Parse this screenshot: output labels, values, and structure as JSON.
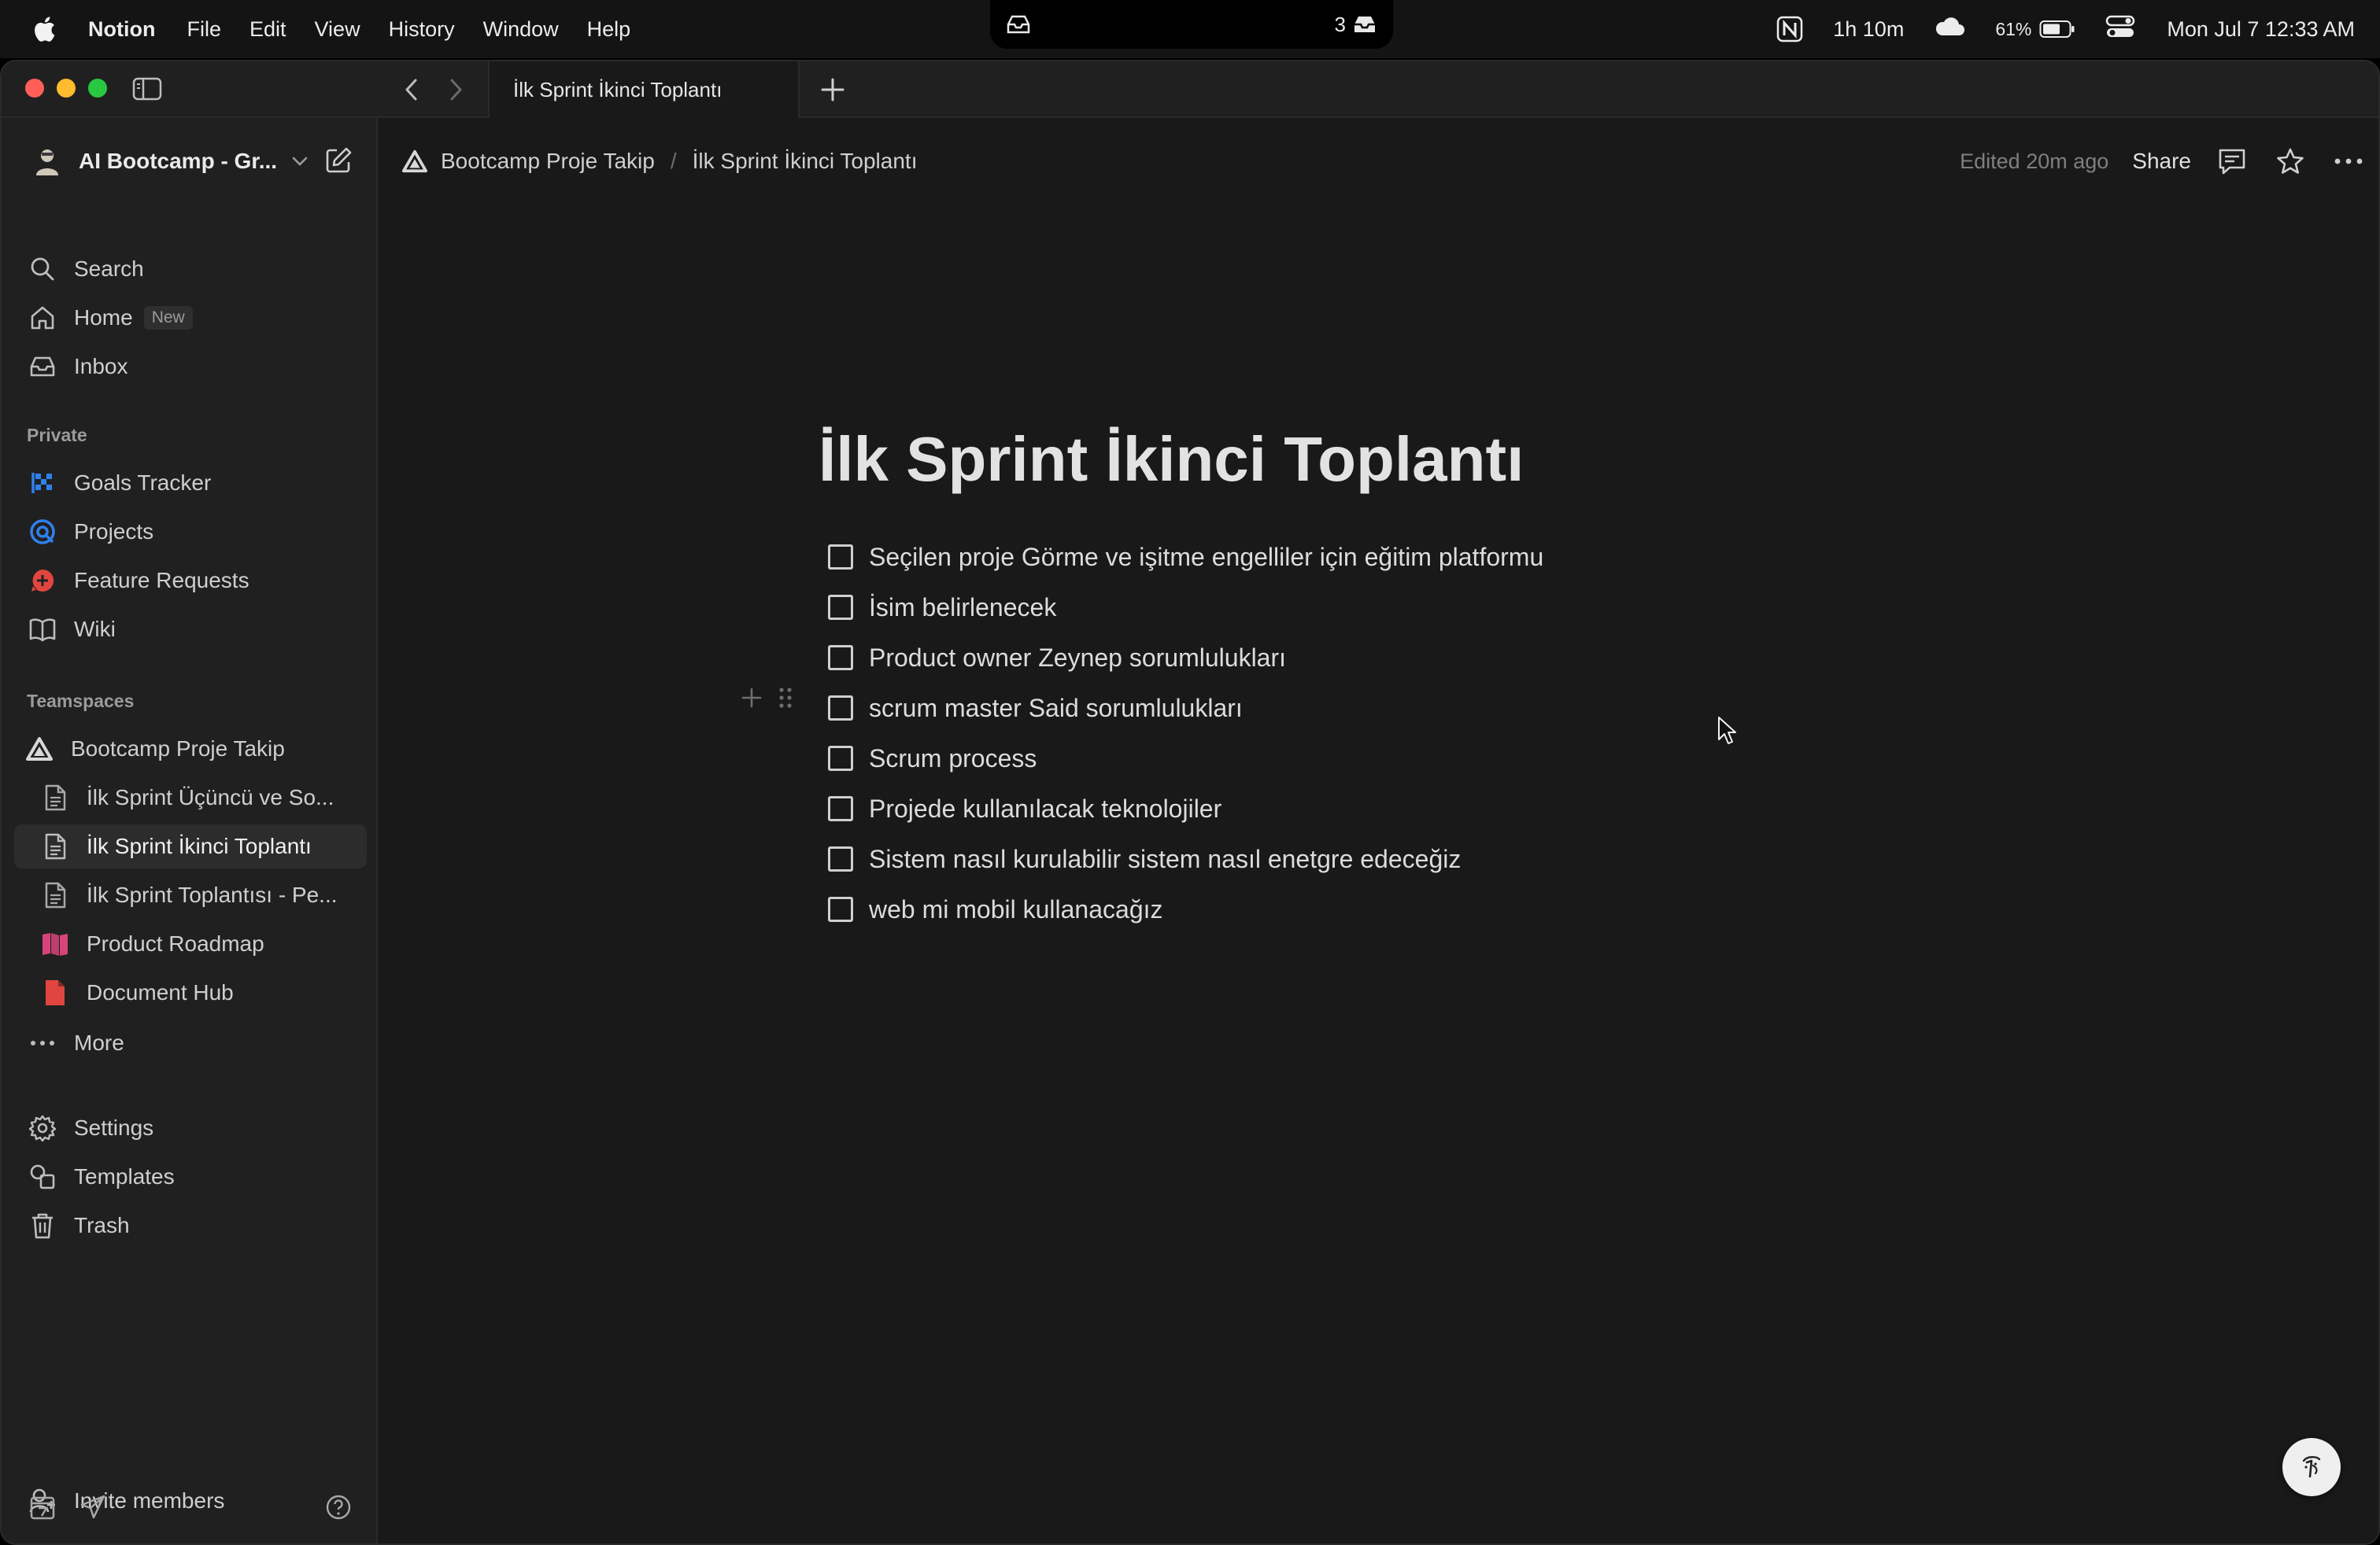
{
  "menubar": {
    "app_name": "Notion",
    "menus": [
      "File",
      "Edit",
      "View",
      "History",
      "Window",
      "Help"
    ],
    "notch_count": "3",
    "timer": "1h 10m",
    "battery": "61%",
    "datetime": "Mon Jul 7  12:33 AM"
  },
  "tabbar": {
    "active_tab": "İlk Sprint İkinci Toplantı"
  },
  "sidebar": {
    "workspace": "AI Bootcamp - Gr...",
    "top_items": [
      {
        "label": "Search",
        "icon": "search-icon"
      },
      {
        "label": "Home",
        "icon": "home-icon",
        "badge": "New"
      },
      {
        "label": "Inbox",
        "icon": "inbox-icon"
      }
    ],
    "private_header": "Private",
    "private_items": [
      {
        "label": "Goals Tracker",
        "icon": "goals-icon"
      },
      {
        "label": "Projects",
        "icon": "projects-icon"
      },
      {
        "label": "Feature Requests",
        "icon": "feature-requests-icon"
      },
      {
        "label": "Wiki",
        "icon": "wiki-icon"
      }
    ],
    "teamspaces_header": "Teamspaces",
    "teamspace": "Bootcamp Proje Takip",
    "teamspace_pages": [
      {
        "label": "İlk Sprint Üçüncü ve So...",
        "icon": "page-icon"
      },
      {
        "label": "İlk Sprint İkinci Toplantı",
        "icon": "page-icon",
        "selected": true
      },
      {
        "label": "İlk Sprint Toplantısı - Pe...",
        "icon": "page-icon"
      },
      {
        "label": "Product Roadmap",
        "icon": "roadmap-icon"
      },
      {
        "label": "Document Hub",
        "icon": "document-hub-icon"
      }
    ],
    "more": "More",
    "settings": "Settings",
    "templates": "Templates",
    "trash": "Trash",
    "invite": "Invite members"
  },
  "topbar": {
    "breadcrumb": [
      "Bootcamp Proje Takip",
      "İlk Sprint İkinci Toplantı"
    ],
    "edited": "Edited 20m ago",
    "share": "Share"
  },
  "page": {
    "title": "İlk Sprint İkinci Toplantı",
    "todos": [
      {
        "text": "Seçilen proje Görme ve işitme engelliler için eğitim platformu",
        "checked": false
      },
      {
        "text": "İsim belirlenecek",
        "checked": false
      },
      {
        "text": "Product owner Zeynep sorumlulukları",
        "checked": false
      },
      {
        "text": "scrum master Said sorumlulukları",
        "checked": false
      },
      {
        "text": "Scrum process",
        "checked": false
      },
      {
        "text": "Projede kullanılacak teknolojiler",
        "checked": false
      },
      {
        "text": "Sistem nasıl kurulabilir sistem nasıl enetgre edeceğiz",
        "checked": false
      },
      {
        "text": "web mi mobil kullanacağız",
        "checked": false
      }
    ]
  },
  "colors": {
    "background": "#191919",
    "sidebar": "#202020",
    "goals": "#2f80ed",
    "feature_requests": "#e0463f",
    "roadmap": "#d6457a",
    "document_hub": "#e0463f"
  }
}
